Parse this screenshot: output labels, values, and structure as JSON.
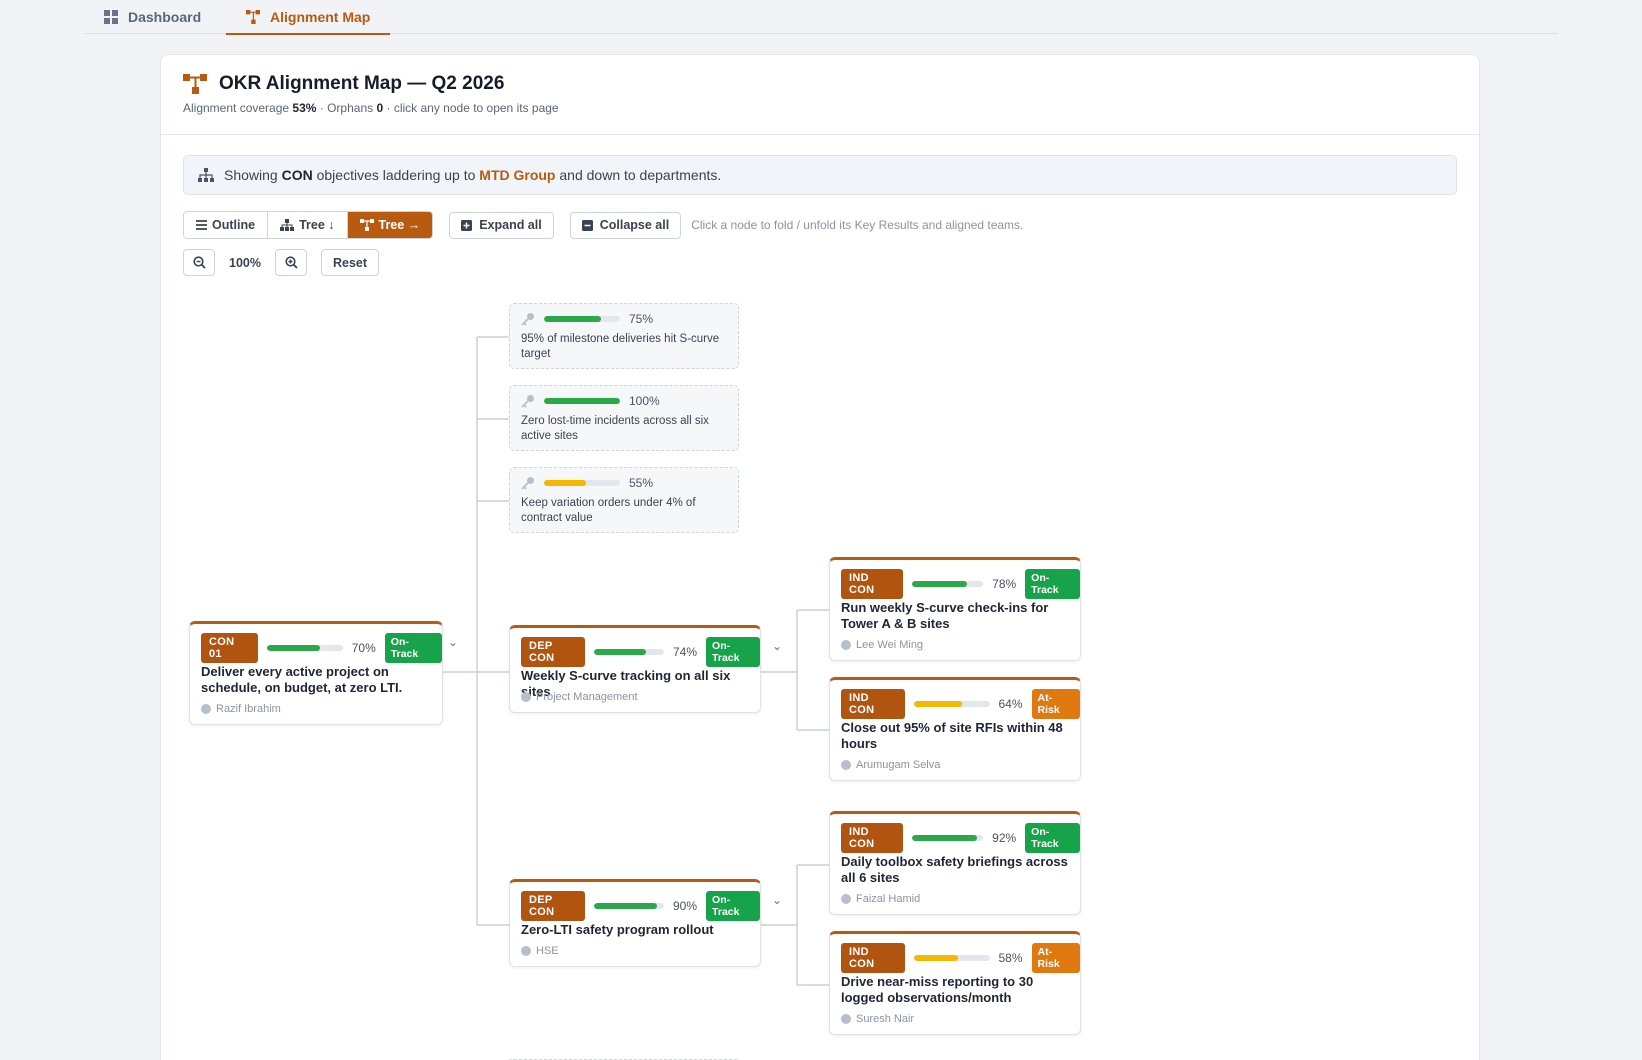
{
  "tabs": [
    {
      "label": "Dashboard",
      "icon": "dashboard-grid-icon"
    },
    {
      "label": "Alignment Map",
      "icon": "alignment-map-icon"
    }
  ],
  "header": {
    "title": "OKR Alignment Map — Q2 2026",
    "coverage_prefix": "Alignment coverage ",
    "coverage_value": "53%",
    "orphans_prefix": " · Orphans ",
    "orphans_value": "0",
    "suffix": " · click any node to open its page"
  },
  "banner": {
    "prefix": "Showing ",
    "unit": "CON",
    "middle": " objectives laddering up to ",
    "group": "MTD Group",
    "suffix": " and down to departments."
  },
  "controls": {
    "views": [
      "Outline",
      "Tree ↓",
      "Tree →"
    ],
    "active_view": "Tree →",
    "expand_all": "Expand all",
    "collapse_all": "Collapse all",
    "hint": "Click a node to fold / unfold its Key Results and aligned teams.",
    "zoom_level": "100%",
    "reset": "Reset"
  },
  "colors": {
    "accent": "#b85a10",
    "on_track": "#17a34a",
    "at_risk": "#e07a10",
    "bar_green": "#2aa84a",
    "bar_yellow": "#f5b800"
  },
  "root": {
    "tag": "CON 01",
    "progress": 70,
    "progress_label": "70%",
    "status": "On-Track",
    "title": "Deliver every active project on schedule, on budget, at zero LTI.",
    "owner": "Razif Ibrahim"
  },
  "key_results": [
    {
      "progress": 75,
      "progress_label": "75%",
      "text": "95% of milestone deliveries hit S-curve target"
    },
    {
      "progress": 100,
      "progress_label": "100%",
      "text": "Zero lost-time incidents across all six active sites"
    },
    {
      "progress": 55,
      "progress_label": "55%",
      "text": "Keep variation orders under 4% of contract value"
    }
  ],
  "departments": [
    {
      "tag": "DEP CON",
      "progress": 74,
      "progress_label": "74%",
      "status": "On-Track",
      "title": "Weekly S-curve tracking on all six sites",
      "owner": "Project Management",
      "children": [
        {
          "tag": "IND CON",
          "progress": 78,
          "progress_label": "78%",
          "status": "On-Track",
          "title": "Run weekly S-curve check-ins for Tower A & B sites",
          "owner": "Lee Wei Ming"
        },
        {
          "tag": "IND CON",
          "progress": 64,
          "progress_label": "64%",
          "status": "At-Risk",
          "title": "Close out 95% of site RFIs within 48 hours",
          "owner": "Arumugam Selva"
        }
      ]
    },
    {
      "tag": "DEP CON",
      "progress": 90,
      "progress_label": "90%",
      "status": "On-Track",
      "title": "Zero-LTI safety program rollout",
      "owner": "HSE",
      "children": [
        {
          "tag": "IND CON",
          "progress": 92,
          "progress_label": "92%",
          "status": "On-Track",
          "title": "Daily toolbox safety briefings across all 6 sites",
          "owner": "Faizal Hamid"
        },
        {
          "tag": "IND CON",
          "progress": 58,
          "progress_label": "58%",
          "status": "At-Risk",
          "title": "Drive near-miss reporting to 30 logged observations/month",
          "owner": "Suresh Nair"
        }
      ]
    }
  ]
}
